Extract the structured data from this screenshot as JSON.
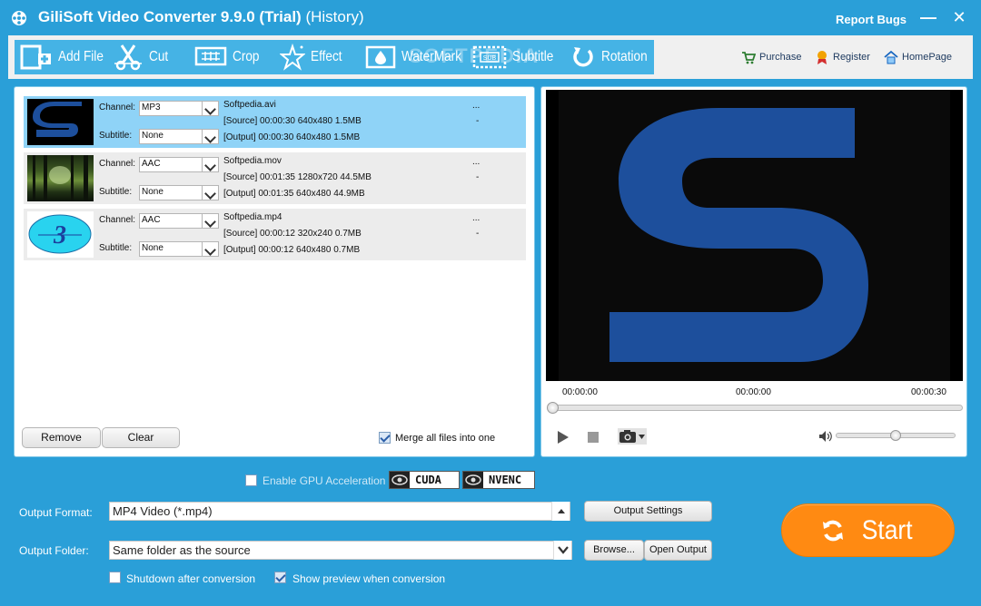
{
  "window": {
    "title_main": "GiliSoft Video Converter 9.9.0 (Trial)",
    "title_sub": "(History)",
    "report_bugs": "Report Bugs",
    "minimize": "—",
    "close": "✕"
  },
  "toolbar": {
    "add_file": "Add File",
    "cut": "Cut",
    "crop": "Crop",
    "effect": "Effect",
    "watermark": "WaterMark",
    "subtitle": "Subtitle",
    "rotation": "Rotation",
    "overlay_watermark": "SOFTPEDIA"
  },
  "links": {
    "purchase": "Purchase",
    "register": "Register",
    "homepage": "HomePage"
  },
  "files": [
    {
      "channel_label": "Channel:",
      "channel": "MP3",
      "subtitle_label": "Subtitle:",
      "subtitle": "None",
      "name": "Softpedia.avi",
      "source": "[Source]  00:00:30  640x480  1.5MB",
      "output": "[Output]  00:00:30  640x480  1.5MB",
      "more": "...",
      "dash": "-"
    },
    {
      "channel_label": "Channel:",
      "channel": "AAC",
      "subtitle_label": "Subtitle:",
      "subtitle": "None",
      "name": "Softpedia.mov",
      "source": "[Source]  00:01:35  1280x720  44.5MB",
      "output": "[Output]  00:01:35  640x480  44.9MB",
      "more": "...",
      "dash": "-"
    },
    {
      "channel_label": "Channel:",
      "channel": "AAC",
      "subtitle_label": "Subtitle:",
      "subtitle": "None",
      "name": "Softpedia.mp4",
      "source": "[Source]  00:00:12  320x240  0.7MB",
      "output": "[Output]  00:00:12  640x480  0.7MB",
      "more": "...",
      "dash": "-"
    }
  ],
  "list_actions": {
    "remove": "Remove",
    "clear": "Clear",
    "merge": "Merge all files into one"
  },
  "player": {
    "time_left": "00:00:00",
    "time_mid": "00:00:00",
    "time_right": "00:00:30",
    "seek_fraction": 0.0,
    "volume_fraction": 0.5
  },
  "gpu": {
    "label": "Enable GPU Acceleration",
    "cuda": "CUDA",
    "nvenc": "NVENC"
  },
  "output": {
    "format_label": "Output Format:",
    "format_value": "MP4 Video (*.mp4)",
    "folder_label": "Output Folder:",
    "folder_value": "Same folder as the source",
    "settings_btn": "Output Settings",
    "browse_btn": "Browse...",
    "open_output_btn": "Open Output",
    "shutdown": "Shutdown after conversion",
    "preview": "Show preview when conversion"
  },
  "start": {
    "label": "Start"
  },
  "colors": {
    "chrome": "#2a9fd8",
    "toolbar": "#45b3e5",
    "selected_row": "#8fd3f7",
    "start": "#ff8a12"
  }
}
